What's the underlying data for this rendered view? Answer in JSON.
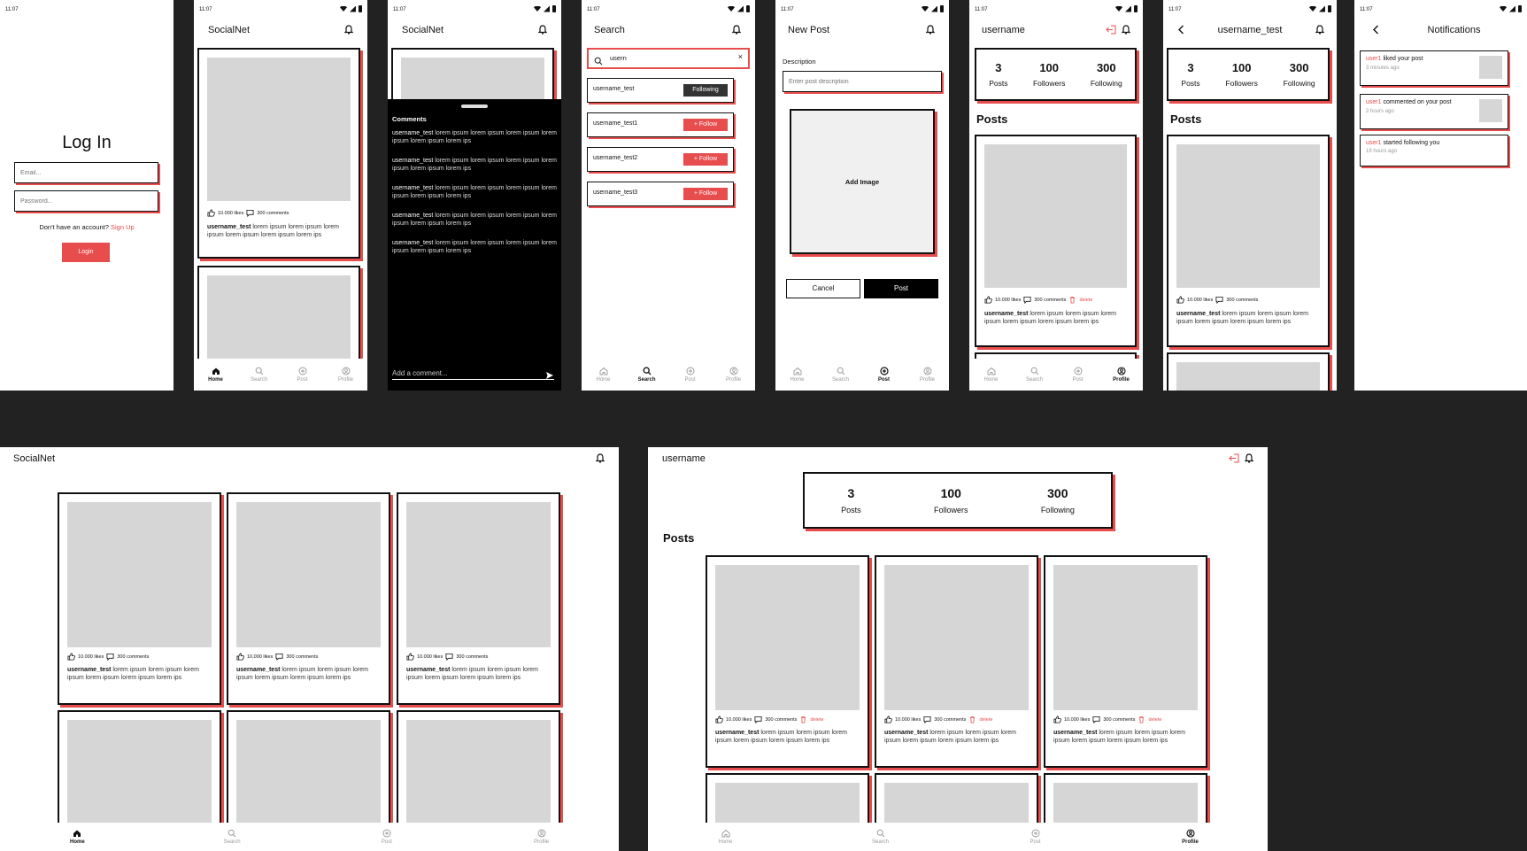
{
  "status": {
    "time": "11:07"
  },
  "login": {
    "title": "Log In",
    "email_placeholder": "Email...",
    "password_placeholder": "Password...",
    "no_account": "Don't have an account?",
    "signup": "Sign Up",
    "login_button": "Login"
  },
  "app": {
    "name": "SocialNet"
  },
  "nav": {
    "home": "Home",
    "search": "Search",
    "post": "Post",
    "profile": "Profile"
  },
  "post": {
    "likes": "10.000 likes",
    "comments": "300 comments",
    "delete": "delete",
    "author": "username_test",
    "text": "lorem ipsum lorem ipsum lorem ipsum lorem ipsum lorem ipsum lorem ips"
  },
  "comments_sheet": {
    "title": "Comments",
    "items": [
      {
        "user": "username_test",
        "text": "lorem ipsum lorem ipsum lorem ipsum lorem ipsum lorem ipsum lorem ips"
      },
      {
        "user": "username_test",
        "text": "lorem ipsum lorem ipsum lorem ipsum lorem ipsum lorem ipsum lorem ips"
      },
      {
        "user": "username_test",
        "text": "lorem ipsum lorem ipsum lorem ipsum lorem ipsum lorem ipsum lorem ips"
      },
      {
        "user": "username_test",
        "text": "lorem ipsum lorem ipsum lorem ipsum lorem ipsum lorem ipsum lorem ips"
      },
      {
        "user": "username_test",
        "text": "lorem ipsum lorem ipsum lorem ipsum lorem ipsum lorem ipsum lorem ips"
      }
    ],
    "input_placeholder": "Add a comment..."
  },
  "search": {
    "title": "Search",
    "query": "usern",
    "results": [
      {
        "name": "username_test",
        "button": "Following",
        "state": "following"
      },
      {
        "name": "username_test1",
        "button": "+ Follow",
        "state": "follow"
      },
      {
        "name": "username_test2",
        "button": "+ Follow",
        "state": "follow"
      },
      {
        "name": "username_test3",
        "button": "+ Follow",
        "state": "follow"
      }
    ]
  },
  "new_post": {
    "title": "New Post",
    "description_label": "Description",
    "description_placeholder": "Enter post description",
    "add_image": "Add Image",
    "cancel": "Cancel",
    "post": "Post"
  },
  "profile": {
    "title": "username",
    "posts_count": "3",
    "posts_label": "Posts",
    "followers_count": "100",
    "followers_label": "Followers",
    "following_count": "300",
    "following_label": "Following",
    "posts_heading": "Posts"
  },
  "other_profile": {
    "title": "username_test"
  },
  "notifications": {
    "title": "Notifications",
    "items": [
      {
        "user": "user1",
        "action": "liked your post",
        "time": "3 minutes ago"
      },
      {
        "user": "user1",
        "action": "commented on your post",
        "time": "2 hours ago"
      },
      {
        "user": "user1",
        "action": "started following you",
        "time": "19 hours ago"
      }
    ]
  },
  "colors": {
    "accent": "#e84d4d",
    "background": "#222222",
    "placeholder": "#d6d6d6"
  }
}
